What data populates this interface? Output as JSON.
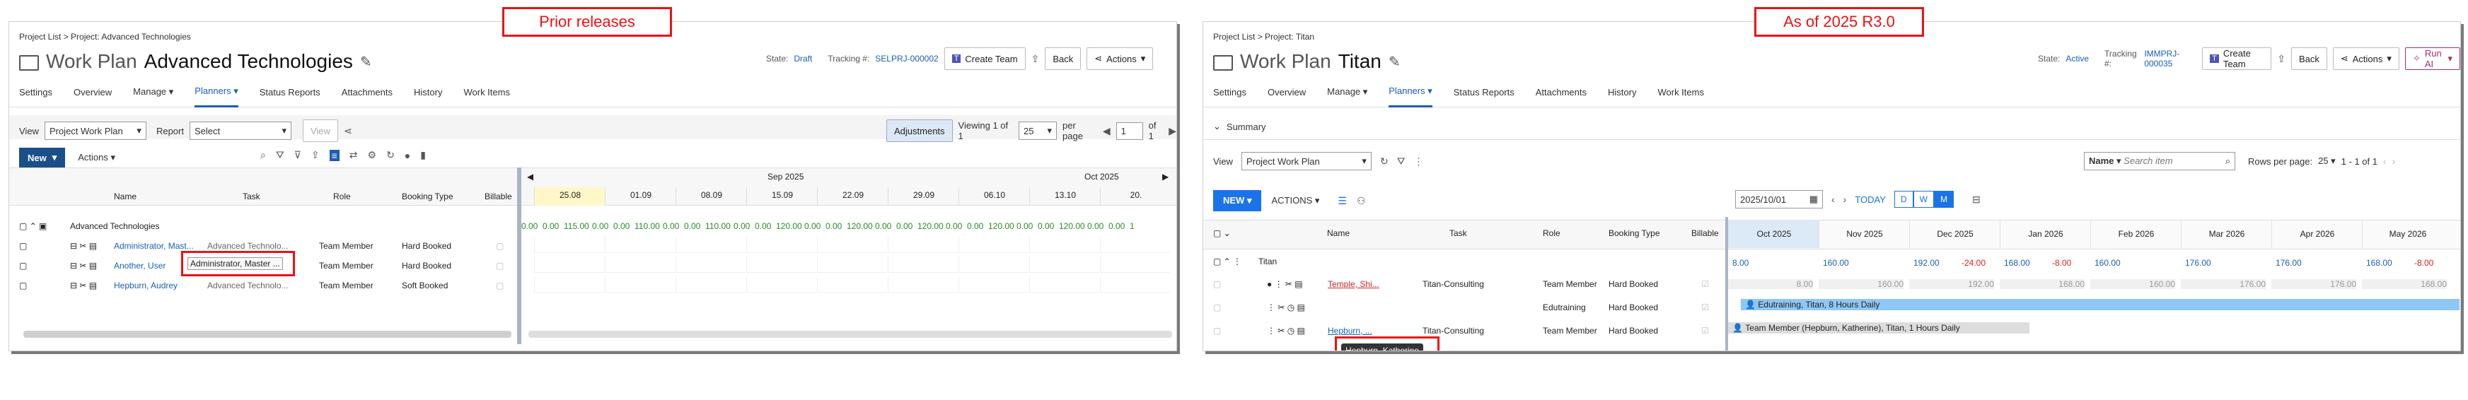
{
  "banners": {
    "left": "Prior releases",
    "right": "As of 2025 R3.0"
  },
  "left": {
    "breadcrumb": "Project List > Project: Advanced Technologies",
    "wp_label": "Work Plan",
    "project_name": "Advanced Technologies",
    "state_label": "State:",
    "state_value": "Draft",
    "tracking_label": "Tracking #:",
    "tracking_value": "SELPRJ-000002",
    "create_team": "Create Team",
    "back": "Back",
    "actions": "Actions",
    "tabs": [
      "Settings",
      "Overview",
      "Manage",
      "Planners",
      "Status Reports",
      "Attachments",
      "History",
      "Work Items"
    ],
    "view_label": "View",
    "view_value": "Project Work Plan",
    "report_label": "Report",
    "report_value": "Select",
    "view_btn": "View",
    "adjustments": "Adjustments",
    "viewing": "Viewing 1 of 1",
    "per_page_val": "25",
    "per_page_label": "per page",
    "page_val": "1",
    "of_label": "of 1",
    "new": "New",
    "actions2": "Actions",
    "cols": [
      "Name",
      "Task",
      "Role",
      "Booking Type",
      "Billable"
    ],
    "months": [
      "Sep 2025",
      "Oct 2025"
    ],
    "weeks": [
      "25.08",
      "01.09",
      "08.09",
      "15.09",
      "22.09",
      "29.09",
      "06.10",
      "13.10",
      "20."
    ],
    "group": "Advanced Technologies",
    "group_vals": [
      [
        "0.00",
        "0.00",
        "115.00"
      ],
      [
        "0.00",
        "0.00",
        "110.00"
      ],
      [
        "0.00",
        "0.00",
        "110.00"
      ],
      [
        "0.00",
        "0.00",
        "120.00"
      ],
      [
        "0.00",
        "0.00",
        "120.00"
      ],
      [
        "0.00",
        "0.00",
        "120.00"
      ],
      [
        "0.00",
        "0.00",
        "120.00"
      ],
      [
        "0.00",
        "0.00",
        "120.00"
      ],
      [
        "0.00",
        "0.00",
        "1"
      ]
    ],
    "rows": [
      {
        "name": "Administrator, Mast...",
        "task": "Advanced Technolo...",
        "role": "Team Member",
        "booking": "Hard Booked"
      },
      {
        "name": "Another, User",
        "task": "Advanced Technolo...",
        "role": "Team Member",
        "booking": "Hard Booked"
      },
      {
        "name": "Hepburn, Audrey",
        "task": "Advanced Technolo...",
        "role": "Team Member",
        "booking": "Soft Booked"
      }
    ],
    "tooltip": "Administrator, Master ..."
  },
  "right": {
    "breadcrumb": "Project List > Project: Titan",
    "wp_label": "Work Plan",
    "project_name": "Titan",
    "state_label": "State:",
    "state_value": "Active",
    "tracking_label": "Tracking #:",
    "tracking_value": "IMMPRJ-000035",
    "create_team": "Create Team",
    "back": "Back",
    "actions": "Actions",
    "run_ai": "Run AI",
    "tabs": [
      "Settings",
      "Overview",
      "Manage",
      "Planners",
      "Status Reports",
      "Attachments",
      "History",
      "Work Items"
    ],
    "summary": "Summary",
    "view_label": "View",
    "view_value": "Project Work Plan",
    "search_name": "Name",
    "search_placeholder": "Search item",
    "rows_per_page": "Rows per page:",
    "rpp_val": "25",
    "range": "1 - 1 of 1",
    "new": "NEW",
    "actions2": "ACTIONS",
    "date_val": "2025/10/01",
    "today": "TODAY",
    "dwm": [
      "D",
      "W",
      "M"
    ],
    "cols": [
      "Name",
      "Task",
      "Role",
      "Booking Type",
      "Billable"
    ],
    "months": [
      "Oct 2025",
      "Nov 2025",
      "Dec 2025",
      "Jan 2026",
      "Feb 2026",
      "Mar 2026",
      "Apr 2026",
      "May 2026"
    ],
    "group": "Titan",
    "group_vals": [
      [
        "8.00",
        ""
      ],
      [
        "160.00",
        ""
      ],
      [
        "192.00",
        "-24.00"
      ],
      [
        "168.00",
        "-8.00"
      ],
      [
        "160.00",
        ""
      ],
      [
        "176.00",
        ""
      ],
      [
        "176.00",
        ""
      ],
      [
        "168.00",
        "-8.00"
      ]
    ],
    "row1_vals": [
      "8.00",
      "160.00",
      "192.00",
      "168.00",
      "160.00",
      "176.00",
      "176.00",
      "168.00"
    ],
    "rows": [
      {
        "name": "Temple, Shi...",
        "task": "Titan-Consulting",
        "role": "Team Member",
        "booking": "Hard Booked"
      },
      {
        "name": "",
        "task": "",
        "role": "Edutraining",
        "booking": "Hard Booked"
      },
      {
        "name": "Hepburn, ...",
        "task": "Titan-Consulting",
        "role": "Team Member",
        "booking": "Hard Booked"
      }
    ],
    "bar_edu": "Edutraining, Titan, 8 Hours Daily",
    "bar_team": "Team Member (Hepburn, Katherine), Titan, 1 Hours Daily",
    "tooltip": "Hepburn, Katherine"
  }
}
